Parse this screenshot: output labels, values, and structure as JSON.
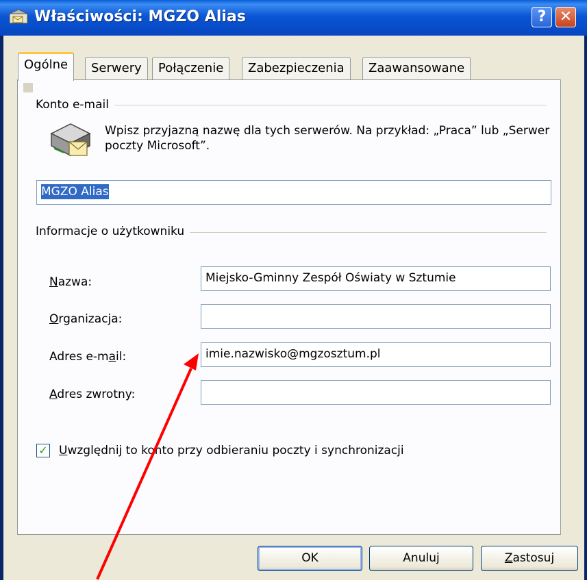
{
  "window": {
    "title": "Właściwości: MGZO Alias",
    "help_glyph": "?",
    "close_glyph": "✕"
  },
  "tabs": [
    {
      "label": "Ogólne",
      "active": true
    },
    {
      "label": "Serwery",
      "active": false
    },
    {
      "label": "Połączenie",
      "active": false
    },
    {
      "label": "Zabezpieczenia",
      "active": false
    },
    {
      "label": "Zaawansowane",
      "active": false
    }
  ],
  "email_account": {
    "group_label": "Konto e-mail",
    "description": "Wpisz przyjazną nazwę dla tych serwerów. Na przykład: „Praca” lub „Serwer poczty Microsoft”.",
    "account_name_value": "MGZO Alias"
  },
  "user_info": {
    "group_label": "Informacje o użytkowniku",
    "name_label": "Nazwa:",
    "name_value": "Miejsko-Gminny Zespół Oświaty w Sztumie",
    "org_label": "Organizacja:",
    "org_value": "",
    "email_label": "Adres e-mail:",
    "email_value": "imie.nazwisko@mgzosztum.pl",
    "reply_label": "Adres zwrotny:",
    "reply_value": ""
  },
  "include_account": {
    "checked": true,
    "label": "Uwzględnij to konto przy odbieraniu poczty i synchronizacji"
  },
  "buttons": {
    "ok": "OK",
    "cancel": "Anuluj",
    "apply": "Zastosuj"
  },
  "icons": {
    "title": "mail-account-icon",
    "server": "mail-server-icon"
  },
  "colors": {
    "titlebar": "#0a56d4",
    "annotation_arrow": "#ff0000",
    "selection": "#316ac5"
  }
}
